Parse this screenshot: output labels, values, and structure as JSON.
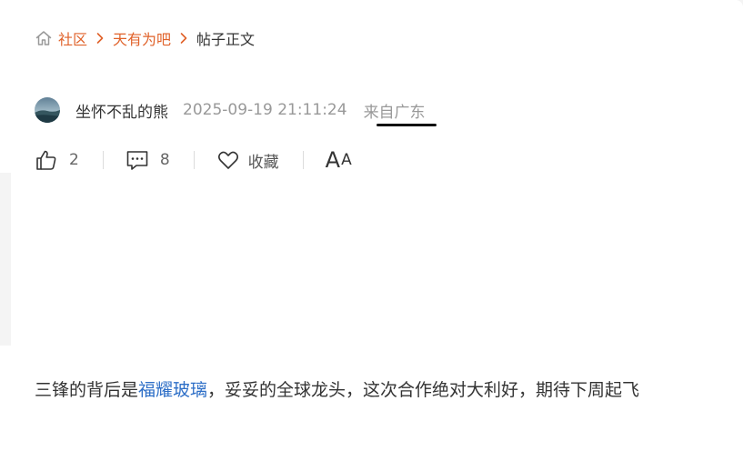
{
  "breadcrumb": {
    "items": [
      "社区",
      "天有为吧"
    ],
    "current": "帖子正文"
  },
  "author": {
    "name": "坐怀不乱的熊",
    "time": "2025-09-19 21:11:24",
    "location": "来自广东"
  },
  "actions": {
    "like_count": "2",
    "comment_count": "8",
    "favorite_label": "收藏",
    "font_big": "A",
    "font_small": "A"
  },
  "post": {
    "text_before": "三锋的背后是",
    "link_text": "福耀玻璃",
    "text_after": "，妥妥的全球龙头，这次合作绝对大利好，期待下周起飞"
  },
  "colors": {
    "accent": "#e0622a",
    "link": "#2e6fc7",
    "muted": "#999999"
  },
  "icons": [
    "home-icon",
    "chevron-right-icon",
    "thumb-up-icon",
    "comment-icon",
    "heart-icon"
  ]
}
